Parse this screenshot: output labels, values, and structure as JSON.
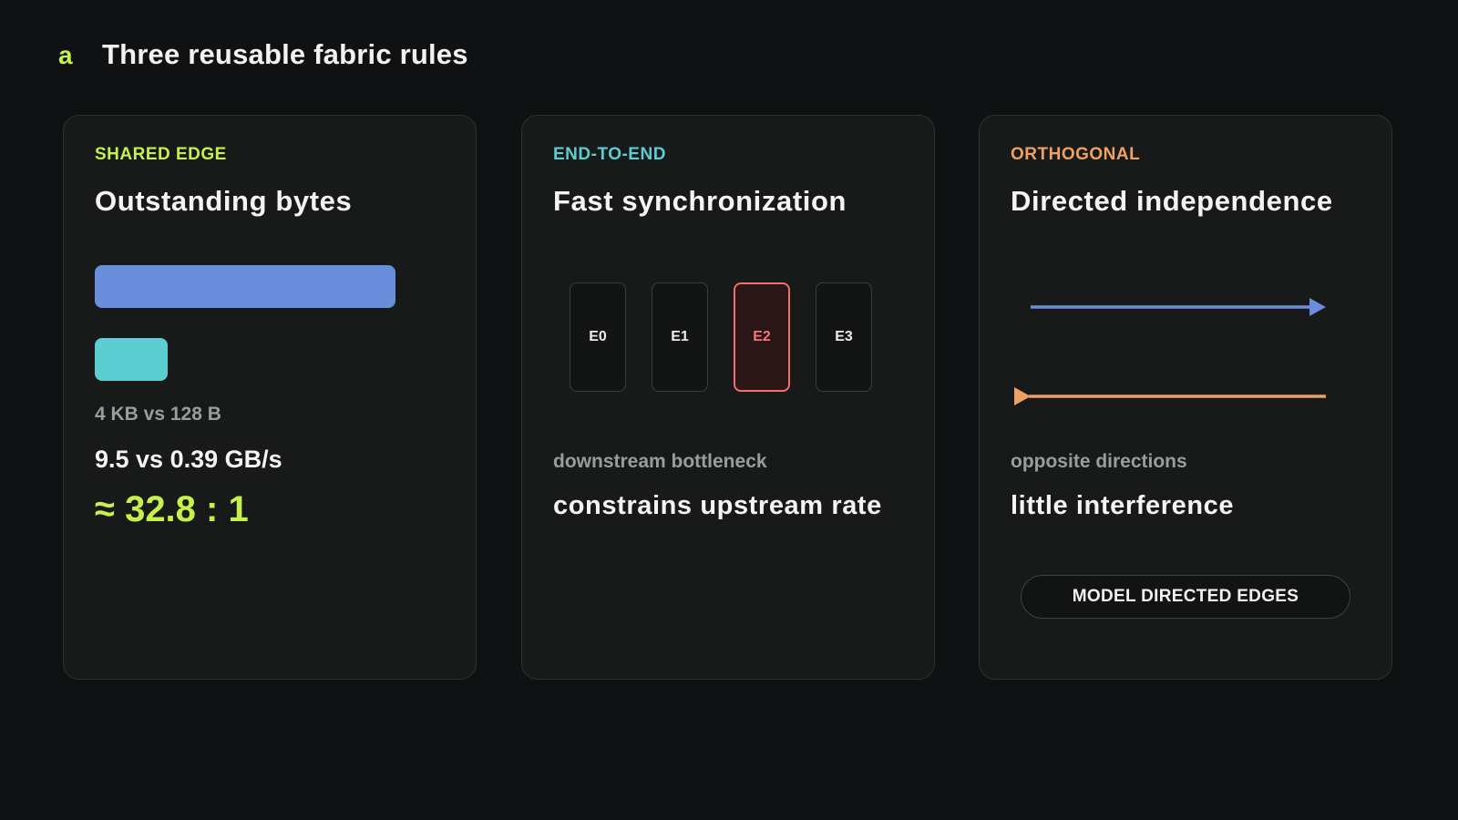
{
  "header": {
    "panel_letter": "a",
    "title": "Three reusable fabric rules"
  },
  "cards": [
    {
      "tag": "SHARED EDGE",
      "title": "Outstanding bytes",
      "compare": "4 KB vs 128 B",
      "rate": "9.5 vs 0.39 GB/s",
      "ratio": "≈ 32.8 : 1"
    },
    {
      "tag": "END-TO-END",
      "title": "Fast synchronization",
      "endpoints": [
        "E0",
        "E1",
        "E2",
        "E3"
      ],
      "bottleneck_endpoint": "E2",
      "note": "downstream bottleneck",
      "conclusion": "constrains upstream rate"
    },
    {
      "tag": "ORTHOGONAL",
      "title": "Directed independence",
      "note": "opposite directions",
      "conclusion": "little interference",
      "button_label": "MODEL DIRECTED EDGES"
    }
  ],
  "colors": {
    "lime": "#c8f04a",
    "cyan": "#5ccdd0",
    "orange": "#f0a060",
    "blue": "#6a8edc",
    "red": "#f07070",
    "background": "#0f1112",
    "card": "#181a1a"
  }
}
